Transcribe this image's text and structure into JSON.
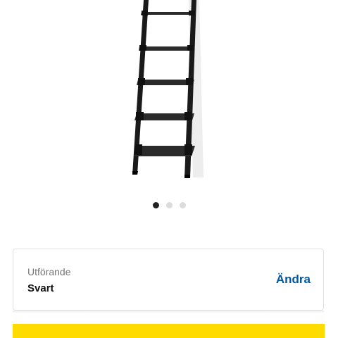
{
  "product": {
    "image_icon": "ladder-shelf-image",
    "color": "#1a1a1a"
  },
  "carousel": {
    "total": 3,
    "active": 1
  },
  "variant": {
    "caption": "Utförande",
    "value": "Svart",
    "change_label": "Ändra"
  },
  "colors": {
    "link": "#0058a3",
    "cta": "#ffdb00",
    "dot_active": "#222222",
    "dot_inactive": "#dcdcdc"
  }
}
